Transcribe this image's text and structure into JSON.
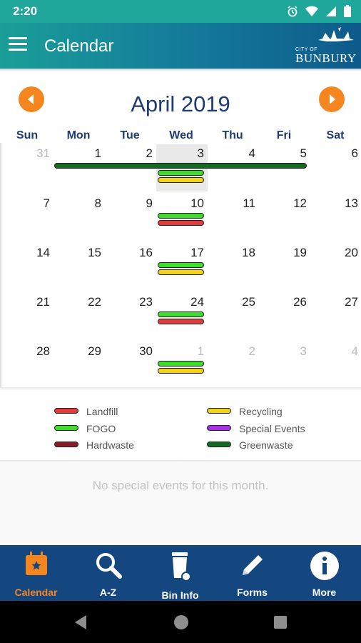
{
  "status_bar": {
    "time": "2:20",
    "icons": [
      "alarm-icon",
      "wifi-icon",
      "signal-icon",
      "battery-icon"
    ]
  },
  "app_bar": {
    "title": "Calendar",
    "logo_small": "CITY OF",
    "logo_main": "BUNBURY"
  },
  "calendar": {
    "month_title": "April 2019",
    "weekdays": [
      "Sun",
      "Mon",
      "Tue",
      "Wed",
      "Thu",
      "Fri",
      "Sat"
    ],
    "weeks": [
      [
        "31",
        "1",
        "2",
        "3",
        "4",
        "5",
        "6"
      ],
      [
        "7",
        "8",
        "9",
        "10",
        "11",
        "12",
        "13"
      ],
      [
        "14",
        "15",
        "16",
        "17",
        "18",
        "19",
        "20"
      ],
      [
        "21",
        "22",
        "23",
        "24",
        "25",
        "26",
        "27"
      ],
      [
        "28",
        "29",
        "30",
        "1",
        "2",
        "3",
        "4"
      ]
    ],
    "today": "3"
  },
  "legend": [
    {
      "label": "Landfill",
      "color": "#e23b3b"
    },
    {
      "label": "Recycling",
      "color": "#f2d31b"
    },
    {
      "label": "FOGO",
      "color": "#3fdc2d"
    },
    {
      "label": "Special Events",
      "color": "#a630e2"
    },
    {
      "label": "Hardwaste",
      "color": "#8b1a2b"
    },
    {
      "label": "Greenwaste",
      "color": "#136b21"
    }
  ],
  "events_message": "No special events for this month.",
  "bottom_nav": [
    {
      "label": "Calendar",
      "icon": "calendar-icon",
      "active": true
    },
    {
      "label": "A-Z",
      "icon": "search-icon",
      "active": false
    },
    {
      "label": "Bin Info",
      "icon": "bin-icon",
      "active": false
    },
    {
      "label": "Forms",
      "icon": "pencil-icon",
      "active": false
    },
    {
      "label": "More",
      "icon": "info-icon",
      "active": false
    }
  ],
  "colors": {
    "accent": "#f5861f",
    "brand_dark": "#14467f",
    "month_title": "#1d3a73",
    "app_bar": "#1a9e98"
  }
}
